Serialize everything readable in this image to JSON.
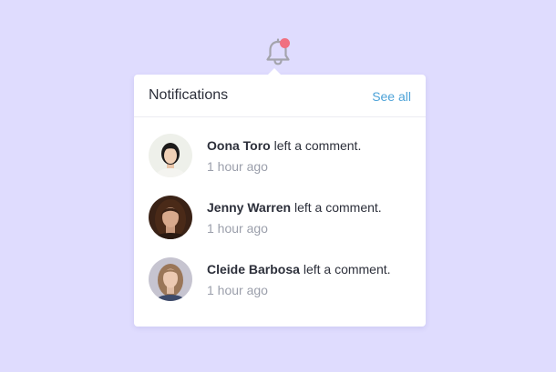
{
  "colors": {
    "background": "#dfdcfe",
    "badge": "#f07080",
    "link": "#4ea3d8"
  },
  "bell": {
    "icon": "bell-icon",
    "has_unread": true
  },
  "panel": {
    "title": "Notifications",
    "see_all": "See all"
  },
  "notifications": [
    {
      "name": "Oona Toro",
      "action": " left a comment.",
      "time": "1 hour ago"
    },
    {
      "name": "Jenny Warren",
      "action": " left a comment.",
      "time": "1 hour ago"
    },
    {
      "name": "Cleide Barbosa",
      "action": " left a comment.",
      "time": "1 hour ago"
    }
  ]
}
